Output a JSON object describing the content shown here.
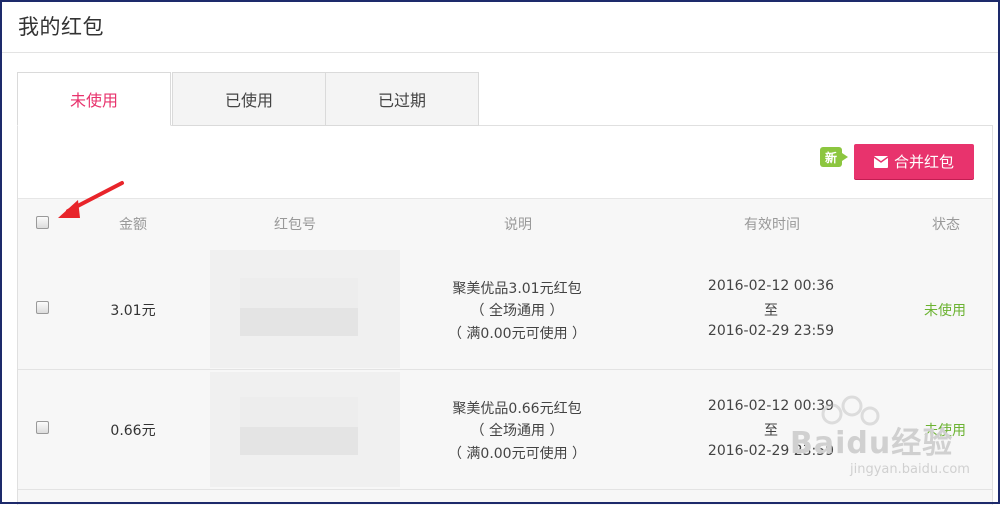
{
  "page": {
    "title": "我的红包"
  },
  "tabs": [
    {
      "label": "未使用",
      "active": true
    },
    {
      "label": "已使用",
      "active": false
    },
    {
      "label": "已过期",
      "active": false
    }
  ],
  "toolbar": {
    "new_badge": "新",
    "merge_button": "合并红包",
    "merge_icon": "envelope-icon"
  },
  "table": {
    "headers": {
      "amount": "金额",
      "code": "红包号",
      "description": "说明",
      "valid_time": "有效时间",
      "status": "状态"
    },
    "rows": [
      {
        "amount": "3.01元",
        "desc_line1": "聚美优品3.01元红包",
        "desc_line2": "（ 全场通用 ）",
        "desc_line3": "（ 满0.00元可使用 ）",
        "time_start": "2016-02-12 00:36",
        "time_to": "至",
        "time_end": "2016-02-29 23:59",
        "status": "未使用"
      },
      {
        "amount": "0.66元",
        "desc_line1": "聚美优品0.66元红包",
        "desc_line2": "（ 全场通用 ）",
        "desc_line3": "（ 满0.00元可使用 ）",
        "time_start": "2016-02-12 00:39",
        "time_to": "至",
        "time_end": "2016-02-29 23:59",
        "status": "未使用"
      }
    ]
  },
  "watermark": {
    "text": "Baidu经验",
    "sub": "jingyan.baidu.com"
  },
  "colors": {
    "accent": "#e8336d",
    "status_green": "#6cb332",
    "badge_green": "#8cc63f",
    "arrow_red": "#e8242a"
  }
}
